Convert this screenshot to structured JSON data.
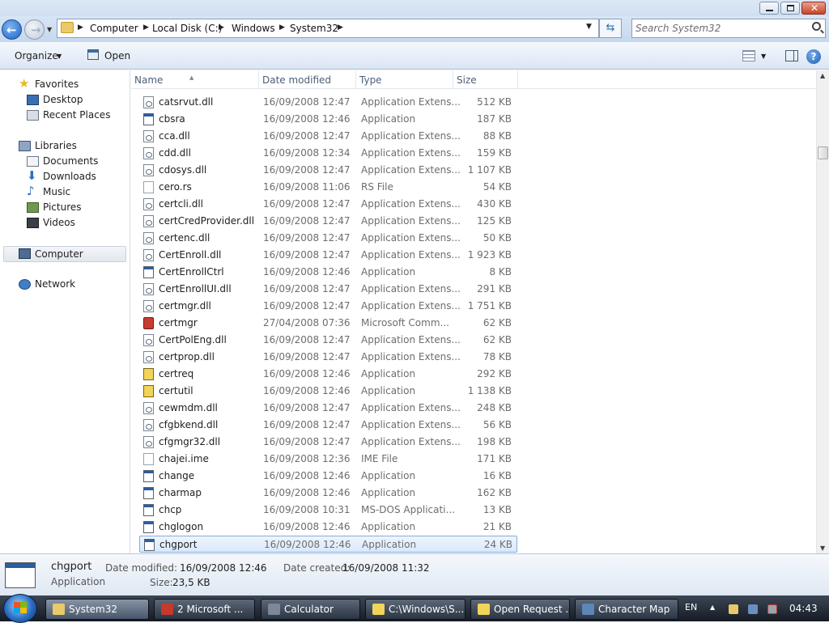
{
  "window": {
    "navigation": {
      "breadcrumbs": [
        "Computer",
        "Local Disk (C:)",
        "Windows",
        "System32"
      ],
      "search_placeholder": "Search System32"
    },
    "toolbar": {
      "organize_label": "Organize",
      "open_label": "Open"
    },
    "nav_pane": {
      "favorites_label": "Favorites",
      "favorites": [
        "Desktop",
        "Recent Places"
      ],
      "libraries_label": "Libraries",
      "libraries": [
        "Documents",
        "Downloads",
        "Music",
        "Pictures",
        "Videos"
      ],
      "computer_label": "Computer",
      "network_label": "Network"
    },
    "columns": {
      "name": "Name",
      "date": "Date modified",
      "type": "Type",
      "size": "Size"
    },
    "files": [
      {
        "name": "catsrvut.dll",
        "date": "16/09/2008 12:47",
        "type": "Application Extens...",
        "size": "512 KB",
        "icon": "dll"
      },
      {
        "name": "cbsra",
        "date": "16/09/2008 12:46",
        "type": "Application",
        "size": "187 KB",
        "icon": "app"
      },
      {
        "name": "cca.dll",
        "date": "16/09/2008 12:47",
        "type": "Application Extens...",
        "size": "88 KB",
        "icon": "dll"
      },
      {
        "name": "cdd.dll",
        "date": "16/09/2008 12:34",
        "type": "Application Extens...",
        "size": "159 KB",
        "icon": "dll"
      },
      {
        "name": "cdosys.dll",
        "date": "16/09/2008 12:47",
        "type": "Application Extens...",
        "size": "1 107 KB",
        "icon": "dll"
      },
      {
        "name": "cero.rs",
        "date": "16/09/2008 11:06",
        "type": "RS File",
        "size": "54 KB",
        "icon": "file"
      },
      {
        "name": "certcli.dll",
        "date": "16/09/2008 12:47",
        "type": "Application Extens...",
        "size": "430 KB",
        "icon": "dll"
      },
      {
        "name": "certCredProvider.dll",
        "date": "16/09/2008 12:47",
        "type": "Application Extens...",
        "size": "125 KB",
        "icon": "dll"
      },
      {
        "name": "certenc.dll",
        "date": "16/09/2008 12:47",
        "type": "Application Extens...",
        "size": "50 KB",
        "icon": "dll"
      },
      {
        "name": "CertEnroll.dll",
        "date": "16/09/2008 12:47",
        "type": "Application Extens...",
        "size": "1 923 KB",
        "icon": "dll"
      },
      {
        "name": "CertEnrollCtrl",
        "date": "16/09/2008 12:46",
        "type": "Application",
        "size": "8 KB",
        "icon": "app"
      },
      {
        "name": "CertEnrollUI.dll",
        "date": "16/09/2008 12:47",
        "type": "Application Extens...",
        "size": "291 KB",
        "icon": "dll"
      },
      {
        "name": "certmgr.dll",
        "date": "16/09/2008 12:47",
        "type": "Application Extens...",
        "size": "1 751 KB",
        "icon": "dll"
      },
      {
        "name": "certmgr",
        "date": "27/04/2008 07:36",
        "type": "Microsoft Comm...",
        "size": "62 KB",
        "icon": "msc"
      },
      {
        "name": "CertPolEng.dll",
        "date": "16/09/2008 12:47",
        "type": "Application Extens...",
        "size": "62 KB",
        "icon": "dll"
      },
      {
        "name": "certprop.dll",
        "date": "16/09/2008 12:47",
        "type": "Application Extens...",
        "size": "78 KB",
        "icon": "dll"
      },
      {
        "name": "certreq",
        "date": "16/09/2008 12:46",
        "type": "Application",
        "size": "292 KB",
        "icon": "cert"
      },
      {
        "name": "certutil",
        "date": "16/09/2008 12:46",
        "type": "Application",
        "size": "1 138 KB",
        "icon": "cert"
      },
      {
        "name": "cewmdm.dll",
        "date": "16/09/2008 12:47",
        "type": "Application Extens...",
        "size": "248 KB",
        "icon": "dll"
      },
      {
        "name": "cfgbkend.dll",
        "date": "16/09/2008 12:47",
        "type": "Application Extens...",
        "size": "56 KB",
        "icon": "dll"
      },
      {
        "name": "cfgmgr32.dll",
        "date": "16/09/2008 12:47",
        "type": "Application Extens...",
        "size": "198 KB",
        "icon": "dll"
      },
      {
        "name": "chajei.ime",
        "date": "16/09/2008 12:36",
        "type": "IME File",
        "size": "171 KB",
        "icon": "file"
      },
      {
        "name": "change",
        "date": "16/09/2008 12:46",
        "type": "Application",
        "size": "16 KB",
        "icon": "app"
      },
      {
        "name": "charmap",
        "date": "16/09/2008 12:46",
        "type": "Application",
        "size": "162 KB",
        "icon": "app"
      },
      {
        "name": "chcp",
        "date": "16/09/2008 10:31",
        "type": "MS-DOS Applicati...",
        "size": "13 KB",
        "icon": "app"
      },
      {
        "name": "chglogon",
        "date": "16/09/2008 12:46",
        "type": "Application",
        "size": "21 KB",
        "icon": "app"
      },
      {
        "name": "chgport",
        "date": "16/09/2008 12:46",
        "type": "Application",
        "size": "24 KB",
        "icon": "app",
        "selected": true
      }
    ],
    "details": {
      "name": "chgport",
      "kind": "Application",
      "date_modified_label": "Date modified:",
      "date_modified": "16/09/2008 12:46",
      "date_created_label": "Date created:",
      "date_created": "16/09/2008 11:32",
      "size_label": "Size:",
      "size": "23,5 KB"
    }
  },
  "taskbar": {
    "items": [
      {
        "label": "System32",
        "active": true,
        "color": "#e9c96a"
      },
      {
        "label": "2 Microsoft ...",
        "active": false,
        "color": "#c6392b"
      },
      {
        "label": "Calculator",
        "active": false,
        "color": "#7c8797"
      },
      {
        "label": "C:\\Windows\\S...",
        "active": false,
        "color": "#f1d45a"
      },
      {
        "label": "Open Request ...",
        "active": false,
        "color": "#f1d45a"
      },
      {
        "label": "Character Map",
        "active": false,
        "color": "#5d86b8"
      }
    ],
    "language": "EN",
    "clock": "04:43"
  }
}
